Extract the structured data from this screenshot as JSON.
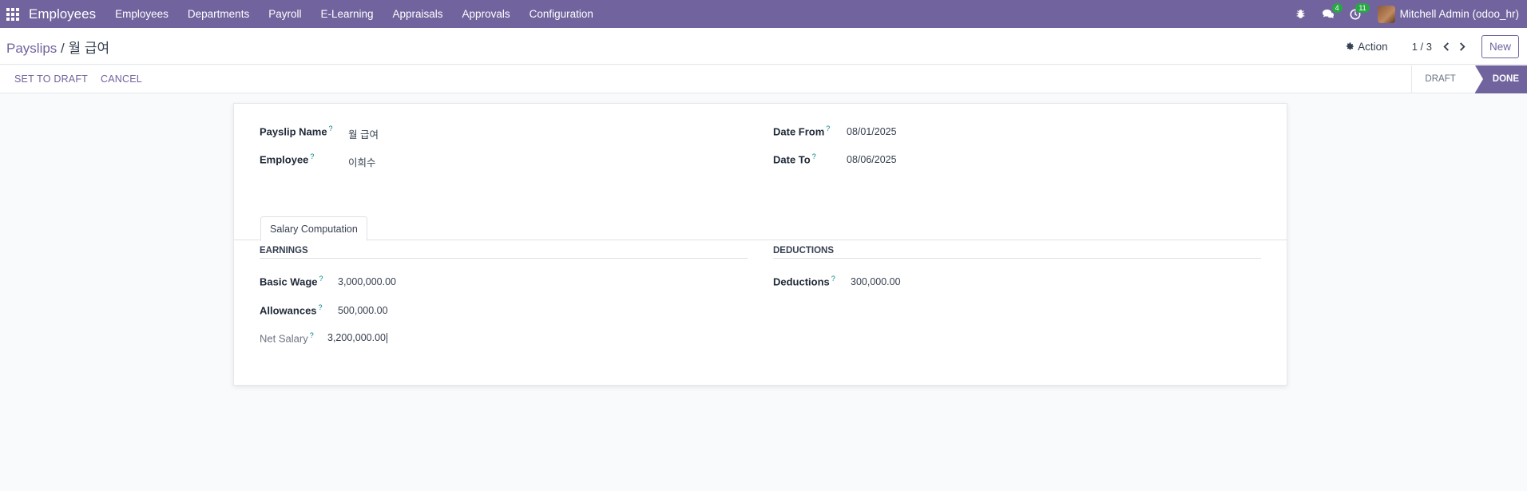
{
  "navbar": {
    "brand": "Employees",
    "menu": [
      "Employees",
      "Departments",
      "Payroll",
      "E-Learning",
      "Appraisals",
      "Approvals",
      "Configuration"
    ],
    "messages_count": "4",
    "activities_count": "11",
    "user": "Mitchell Admin (odoo_hr)"
  },
  "control": {
    "breadcrumb_parent": "Payslips",
    "breadcrumb_separator": " / ",
    "breadcrumb_current": "월 급여",
    "action_label": "Action",
    "pager": "1 / 3",
    "new_label": "New"
  },
  "statusbar": {
    "set_to_draft": "SET TO DRAFT",
    "cancel": "CANCEL",
    "stages": [
      "DRAFT",
      "DONE"
    ],
    "active_stage": "DONE"
  },
  "form": {
    "payslip_name_label": "Payslip Name",
    "payslip_name": "월 급여",
    "employee_label": "Employee",
    "employee": "이희수",
    "date_from_label": "Date From",
    "date_from": "08/01/2025",
    "date_to_label": "Date To",
    "date_to": "08/06/2025",
    "help_mark": "?",
    "tab_label": "Salary Computation",
    "earnings_title": "EARNINGS",
    "basic_wage_label": "Basic Wage",
    "basic_wage": "3,000,000.00",
    "allowances_label": "Allowances",
    "allowances": "500,000.00",
    "net_salary_label": "Net Salary",
    "net_salary": "3,200,000.00",
    "deductions_title": "DEDUCTIONS",
    "deductions_label": "Deductions",
    "deductions": "300,000.00"
  },
  "colors": {
    "brand": "#71639e",
    "badge": "#28a745",
    "help": "#017e84"
  }
}
